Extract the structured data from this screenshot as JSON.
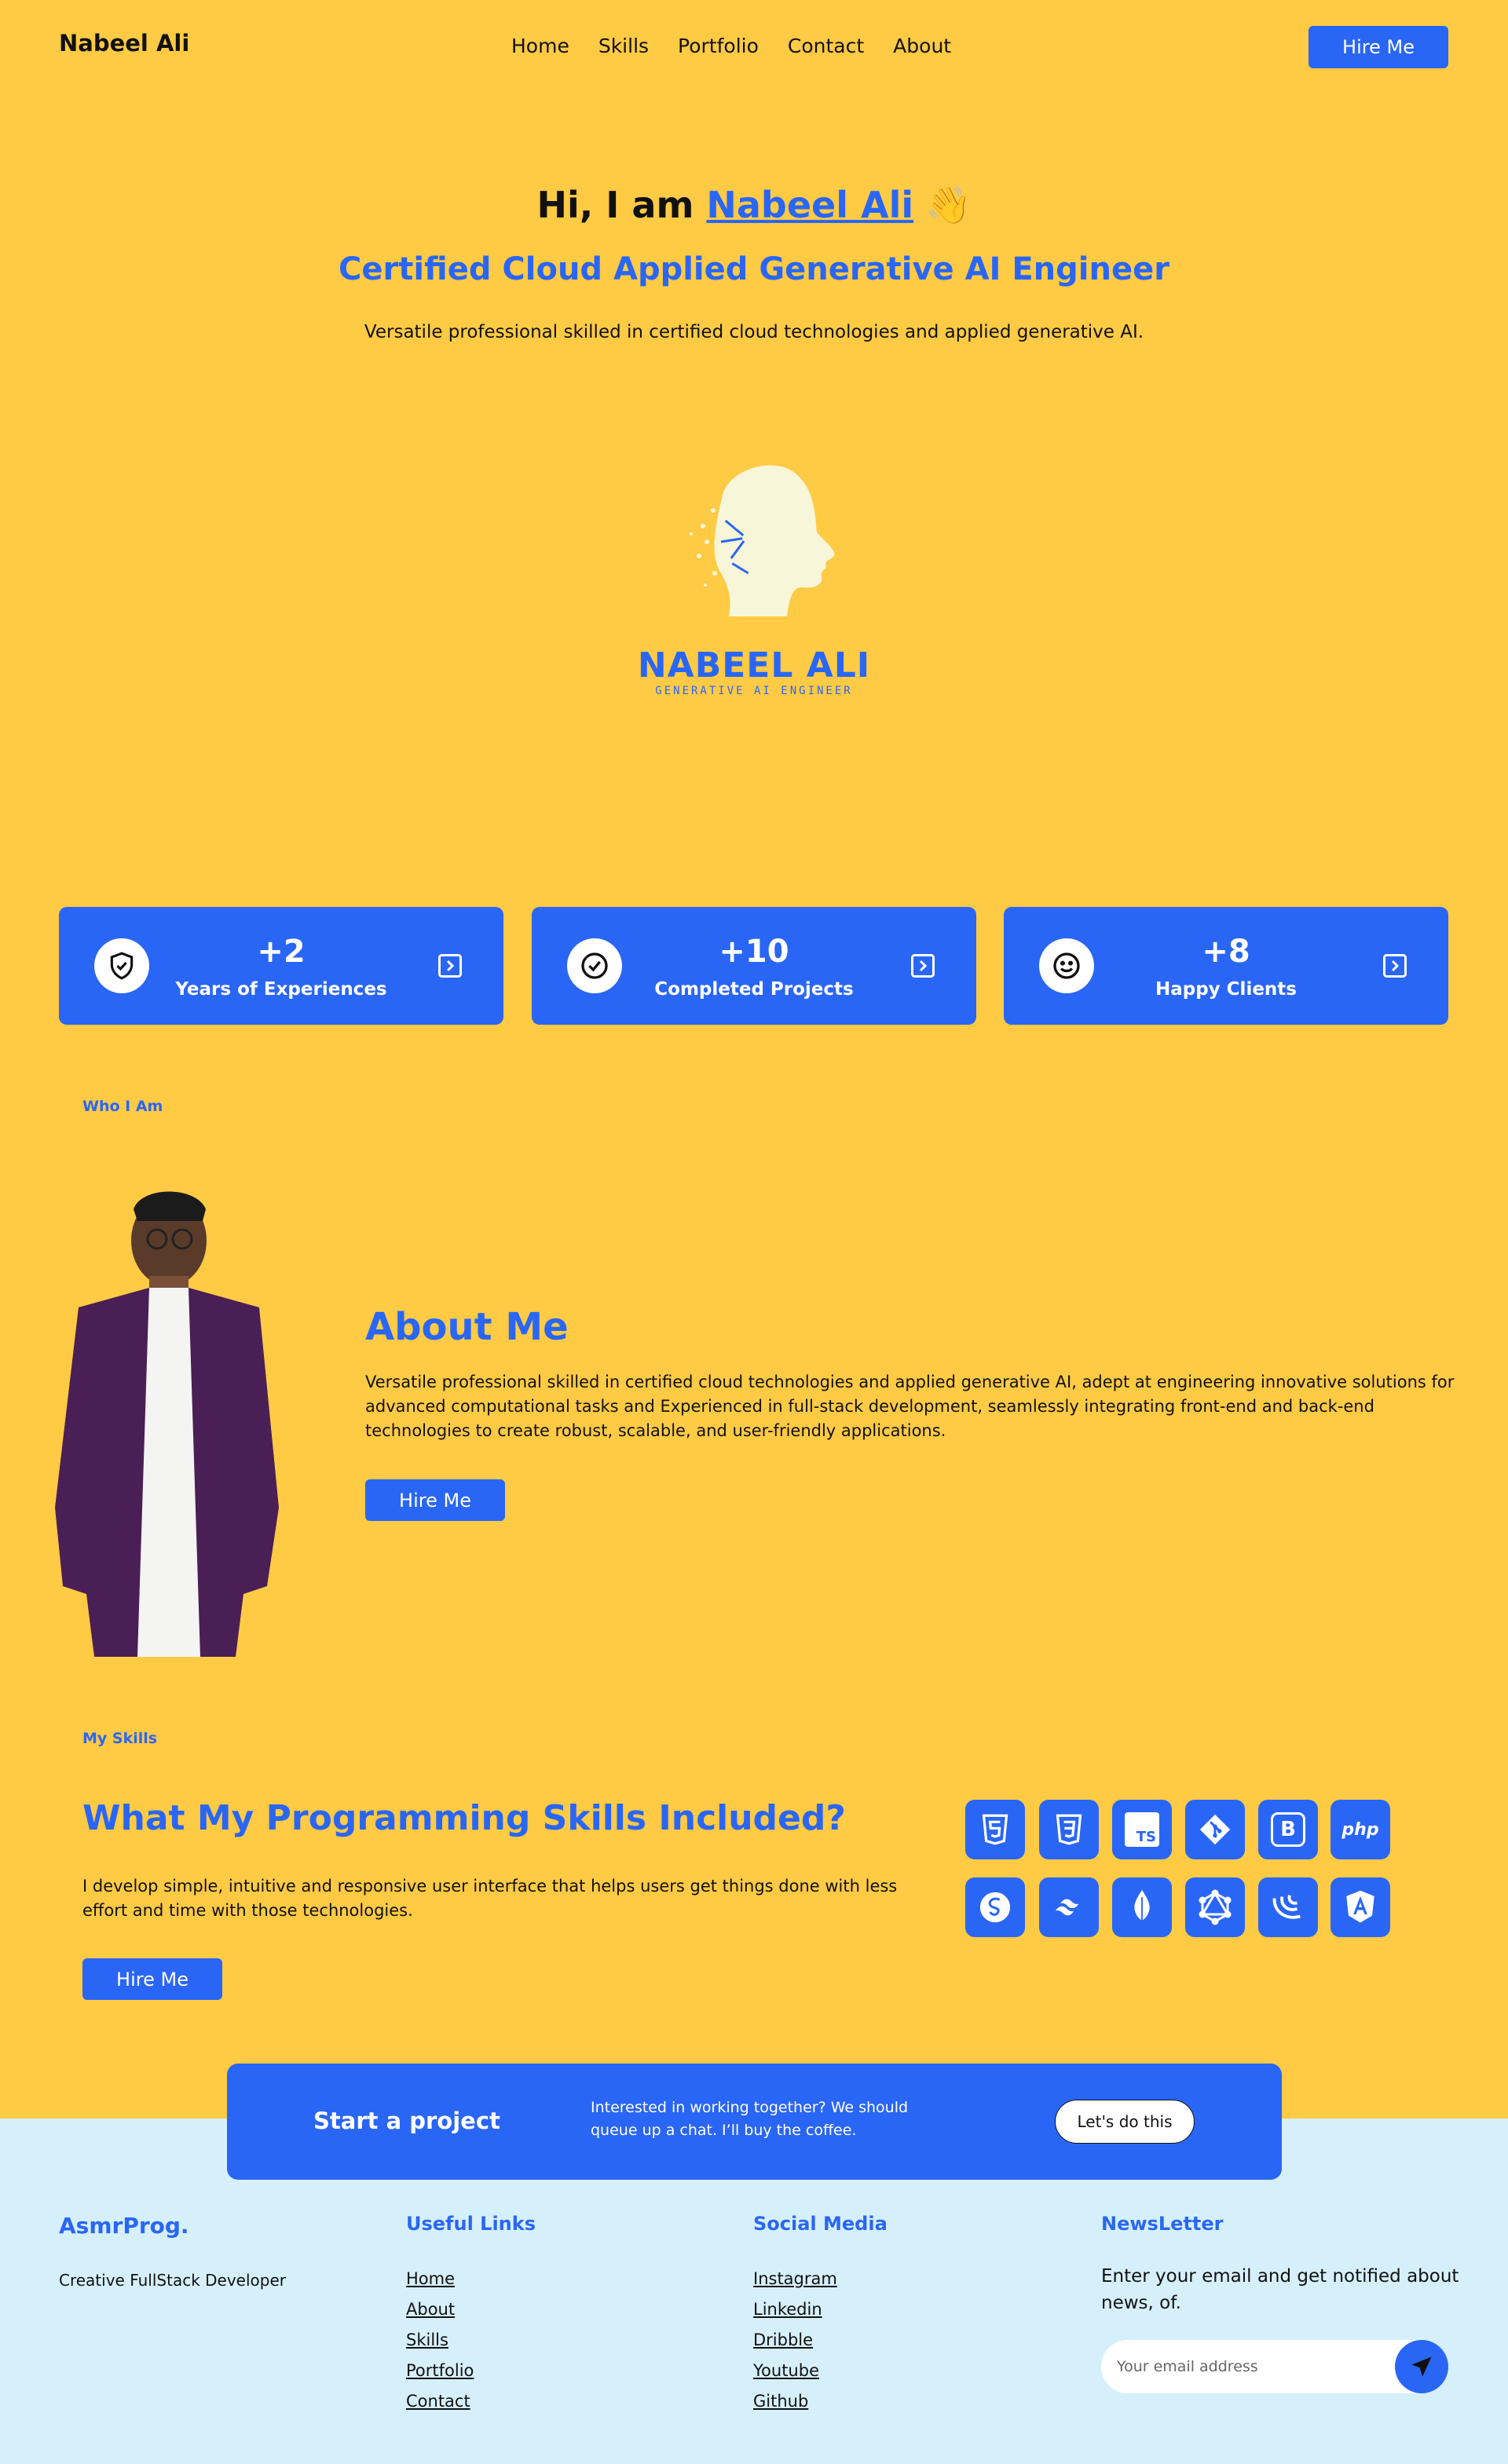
{
  "nav": {
    "brand": "Nabeel Ali",
    "menu": [
      "Home",
      "Skills",
      "Portfolio",
      "Contact",
      "About"
    ],
    "hire_label": "Hire Me"
  },
  "hero": {
    "greeting": "Hi, I am",
    "name": "Nabeel Ali",
    "wave": "👋",
    "title": "Certified Cloud Applied Generative AI Engineer",
    "description": "Versatile professional skilled in certified cloud technologies and applied generative AI."
  },
  "logo": {
    "name": "NABEEL ALI",
    "subtitle": "GENERATIVE AI ENGINEER"
  },
  "stats": [
    {
      "value": "+2",
      "label": "Years of Experiences",
      "icon": "shield-check-icon"
    },
    {
      "value": "+10",
      "label": "Completed Projects",
      "icon": "check-circle-icon"
    },
    {
      "value": "+8",
      "label": "Happy Clients",
      "icon": "smile-icon"
    }
  ],
  "about": {
    "tag": "Who I Am",
    "title": "About Me",
    "text": "Versatile professional skilled in certified cloud technologies and applied generative AI, adept at engineering innovative solutions for advanced computational tasks and Experienced in full-stack development, seamlessly integrating front-end and back-end technologies to create robust, scalable, and user-friendly applications.",
    "hire_label": "Hire Me"
  },
  "skills": {
    "tag": "My Skills",
    "title": "What My Programming Skills Included?",
    "text": "I develop simple, intuitive and responsive user interface that helps users get things done with less effort and time with those technologies.",
    "hire_label": "Hire Me",
    "icons": [
      "html5-icon",
      "css3-icon",
      "typescript-icon",
      "git-icon",
      "bootstrap-icon",
      "php-icon",
      "sass-icon",
      "tailwind-icon",
      "mongodb-icon",
      "graphql-icon",
      "jquery-icon",
      "angular-icon"
    ],
    "icon_text": {
      "ts": "TS",
      "bootstrap": "B",
      "php": "php"
    }
  },
  "cta": {
    "title": "Start a project",
    "text": "Interested in working together? We should queue up a chat. I’ll buy the coffee.",
    "button": "Let's do this"
  },
  "footer": {
    "brand": "AsmrProg.",
    "tagline": "Creative FullStack Developer",
    "useful_links_title": "Useful Links",
    "useful_links": [
      "Home",
      "About",
      "Skills",
      "Portfolio",
      "Contact"
    ],
    "social_title": "Social Media",
    "social_links": [
      "Instagram",
      "Linkedin",
      "Dribble",
      "Youtube",
      "Github"
    ],
    "newsletter_title": "NewsLetter",
    "newsletter_text": "Enter your email and get notified about news, of.",
    "email_placeholder": "Your email address"
  },
  "colors": {
    "accent": "#2A66F5",
    "background": "#FFCA44",
    "footer": "#D6F0FB"
  }
}
